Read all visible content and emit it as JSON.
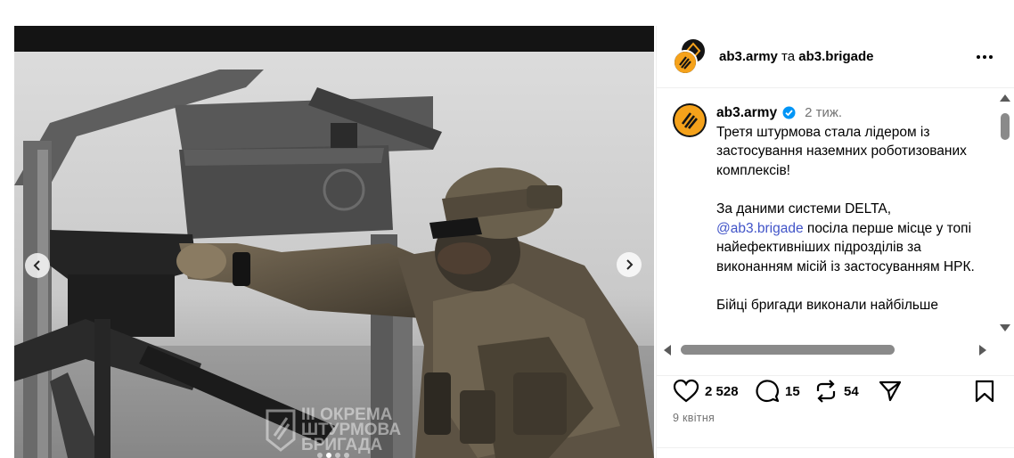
{
  "post": {
    "author": "ab3.army",
    "connector": "та",
    "collaborator": "ab3.brigade",
    "more_icon": "more-horizontal-icon"
  },
  "media": {
    "watermark_lines": [
      "III ОКРЕМА",
      "ШТУРМОВА",
      "БРИГАДА"
    ],
    "prev_icon": "chevron-left-icon",
    "next_icon": "chevron-right-icon"
  },
  "caption": {
    "username": "ab3.army",
    "time_ago": "2 тиж.",
    "para1": "Третя штурмова стала лідером із застосування наземних роботизованих комплексів!",
    "para2_pre": "За даними системи DELTA,",
    "para2_mention": "@ab3.brigade",
    "para2_post": "посіла перше місце у топі найефективніших підрозділів за виконанням місій із застосуванням НРК.",
    "para3": "Бійці бригади виконали найбільше"
  },
  "actions": {
    "likes": "2 528",
    "comments": "15",
    "reposts": "54"
  },
  "date": "9 квітня",
  "colors": {
    "brand_orange": "#f5a21b",
    "mention_blue": "#4154c8",
    "verified_blue": "#0095f6",
    "muted_gray": "#737373"
  }
}
